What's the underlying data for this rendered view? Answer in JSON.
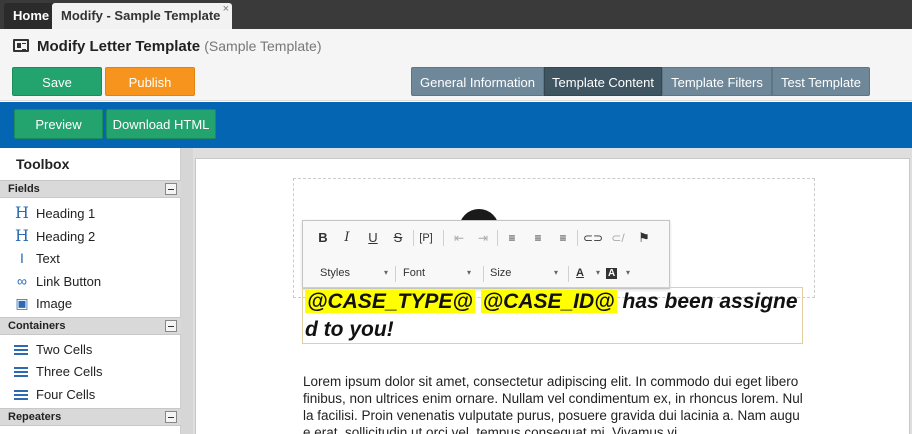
{
  "tabs": {
    "home": "Home",
    "active": "Modify - Sample Template",
    "close": "×"
  },
  "header": {
    "title": "Modify Letter Template",
    "subtitle": "(Sample Template)"
  },
  "actions": {
    "save": "Save",
    "publish": "Publish",
    "nav": [
      "General Information",
      "Template Content",
      "Template Filters",
      "Test Template"
    ],
    "selected": "Template Content"
  },
  "bluebar": {
    "preview": "Preview",
    "download": "Download HTML"
  },
  "toolbox": {
    "title": "Toolbox",
    "fields_label": "Fields",
    "fields": [
      {
        "label": "Heading 1",
        "icon": "heading-icon"
      },
      {
        "label": "Heading 2",
        "icon": "heading-icon"
      },
      {
        "label": "Text",
        "icon": "text-icon"
      },
      {
        "label": "Link Button",
        "icon": "link-icon"
      },
      {
        "label": "Image",
        "icon": "image-icon"
      }
    ],
    "containers_label": "Containers",
    "containers": [
      {
        "label": "Two Cells",
        "icon": "list-icon"
      },
      {
        "label": "Three Cells",
        "icon": "list-icon"
      },
      {
        "label": "Four Cells",
        "icon": "list-icon"
      }
    ],
    "repeaters_label": "Repeaters"
  },
  "editor": {
    "toolbar": {
      "styles": "Styles",
      "font": "Font",
      "size": "Size"
    },
    "heading": {
      "token1": "@CASE_TYPE@",
      "token2": "@CASE_ID@",
      "rest": " has been assigned to you!"
    },
    "body_text": "Lorem ipsum dolor sit amet, consectetur adipiscing elit. In commodo dui eget libero finibus, non ultrices enim ornare. Nullam vel condimentum ex, in rhoncus lorem. Nulla facilisi. Proin venenatis vulputate purus, posuere gravida dui lacinia a. Nam augue erat, sollicitudin ut orci vel, tempus consequat mi. Vivamus vi"
  },
  "colors": {
    "save": "#23a36d",
    "publish": "#f7941d",
    "bluebar": "#0466b2",
    "nav": "#6e8899",
    "nav_selected": "#3f5562",
    "highlight": "#ffff00"
  }
}
